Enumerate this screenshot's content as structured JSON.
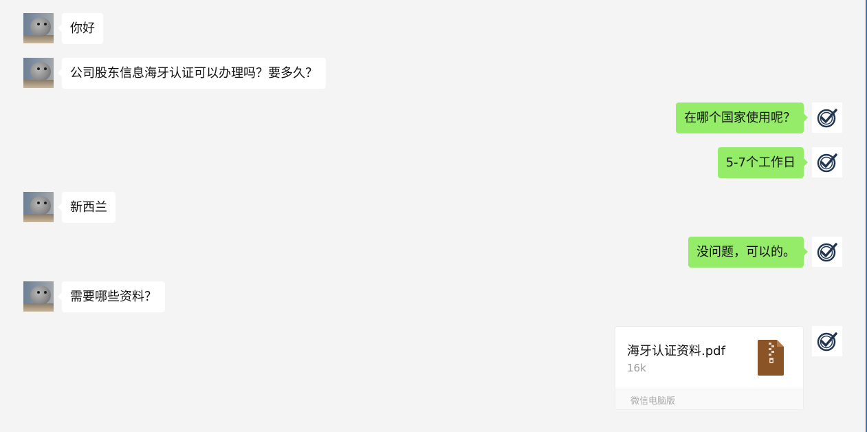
{
  "messages": [
    {
      "side": "left",
      "text": "你好"
    },
    {
      "side": "left",
      "text": "公司股东信息海牙认证可以办理吗？要多久？"
    },
    {
      "side": "right",
      "text": "在哪个国家使用呢？"
    },
    {
      "side": "right",
      "text": "5-7个工作日"
    },
    {
      "side": "left",
      "text": "新西兰"
    },
    {
      "side": "right",
      "text": "没问题，可以的。"
    },
    {
      "side": "left",
      "text": "需要哪些资料？"
    }
  ],
  "file_message": {
    "side": "right",
    "file_name": "海牙认证资料.pdf",
    "file_size": "16k",
    "source": "微信电脑版",
    "icon": "zip-file-icon"
  },
  "avatars": {
    "left": "hamster-avatar",
    "right": "checkmark-avatar"
  },
  "colors": {
    "background": "#f4f4f4",
    "sent_bubble": "#95ec69",
    "received_bubble": "#ffffff",
    "file_icon": "#8b5427"
  }
}
